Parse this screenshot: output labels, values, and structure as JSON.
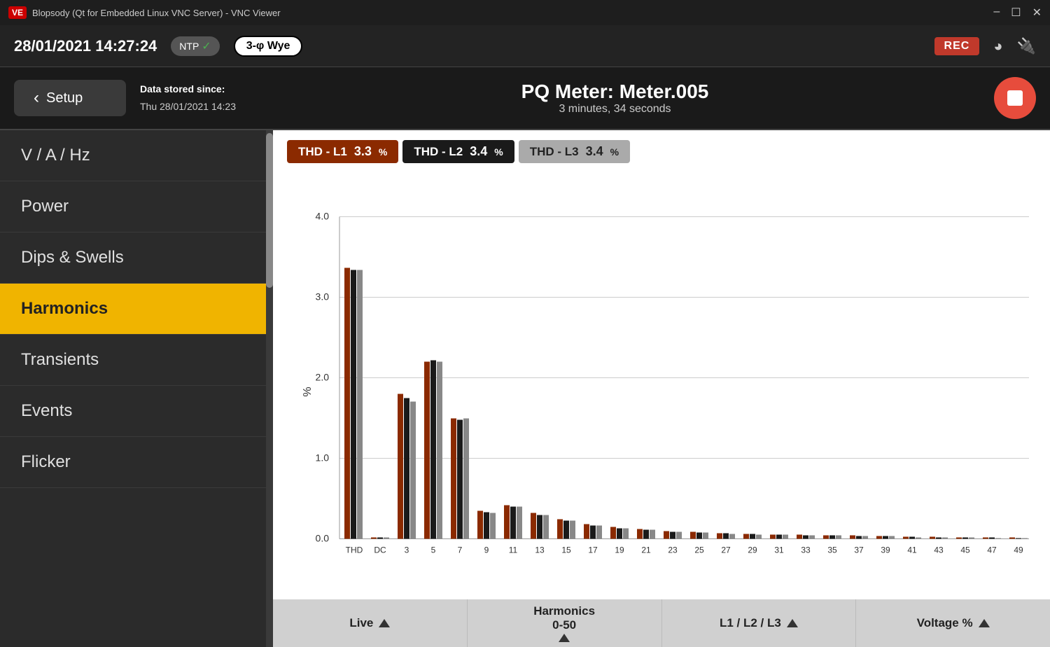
{
  "titlebar": {
    "icon": "VE",
    "title": "Blopsody (Qt for Embedded Linux VNC Server) - VNC Viewer",
    "minimize": "–",
    "maximize": "☐",
    "close": "✕"
  },
  "statusbar": {
    "datetime": "28/01/2021  14:27:24",
    "ntp_label": "NTP",
    "ntp_check": "✓",
    "wye_label": "3-φ Wye",
    "rec_label": "REC"
  },
  "headerbar": {
    "setup_label": "Setup",
    "back_arrow": "‹",
    "data_stored_label": "Data stored since:",
    "data_stored_date": "Thu 28/01/2021 14:23",
    "meter_title": "PQ Meter: Meter.005",
    "duration": "3 minutes, 34 seconds"
  },
  "sidebar": {
    "items": [
      {
        "id": "v-a-hz",
        "label": "V / A / Hz",
        "active": false
      },
      {
        "id": "power",
        "label": "Power",
        "active": false
      },
      {
        "id": "dips-swells",
        "label": "Dips & Swells",
        "active": false
      },
      {
        "id": "harmonics",
        "label": "Harmonics",
        "active": true
      },
      {
        "id": "transients",
        "label": "Transients",
        "active": false
      },
      {
        "id": "events",
        "label": "Events",
        "active": false
      },
      {
        "id": "flicker",
        "label": "Flicker",
        "active": false
      }
    ]
  },
  "thd": [
    {
      "label": "THD - L1",
      "value": "3.3",
      "unit": "%",
      "class": "l1"
    },
    {
      "label": "THD - L2",
      "value": "3.4",
      "unit": "%",
      "class": "l2"
    },
    {
      "label": "THD - L3",
      "value": "3.4",
      "unit": "%",
      "class": "l3"
    }
  ],
  "chart": {
    "y_axis_label": "%",
    "y_max": 4.0,
    "y_ticks": [
      0.0,
      1.0,
      2.0,
      3.0,
      4.0
    ],
    "x_labels": [
      "THD",
      "DC",
      "3",
      "5",
      "7",
      "9",
      "11",
      "13",
      "15",
      "17",
      "19",
      "21",
      "23",
      "25",
      "27",
      "29",
      "31",
      "33",
      "35",
      "37",
      "39",
      "41",
      "43",
      "45",
      "47",
      "49"
    ],
    "series": {
      "l1_color": "#8b2a00",
      "l2_color": "#1a1a1a",
      "l3_color": "#888",
      "bars": [
        {
          "x": "THD",
          "l1": 3.35,
          "l2": 3.3,
          "l3": 3.3
        },
        {
          "x": "DC",
          "l1": 0.02,
          "l2": 0.02,
          "l3": 0.02
        },
        {
          "x": "3",
          "l1": 1.8,
          "l2": 1.75,
          "l3": 1.7
        },
        {
          "x": "5",
          "l1": 2.2,
          "l2": 2.22,
          "l3": 2.2
        },
        {
          "x": "7",
          "l1": 1.5,
          "l2": 1.48,
          "l3": 1.5
        },
        {
          "x": "9",
          "l1": 0.35,
          "l2": 0.33,
          "l3": 0.32
        },
        {
          "x": "11",
          "l1": 0.42,
          "l2": 0.4,
          "l3": 0.4
        },
        {
          "x": "13",
          "l1": 0.32,
          "l2": 0.3,
          "l3": 0.3
        },
        {
          "x": "15",
          "l1": 0.25,
          "l2": 0.23,
          "l3": 0.23
        },
        {
          "x": "17",
          "l1": 0.18,
          "l2": 0.17,
          "l3": 0.17
        },
        {
          "x": "19",
          "l1": 0.15,
          "l2": 0.13,
          "l3": 0.13
        },
        {
          "x": "21",
          "l1": 0.12,
          "l2": 0.11,
          "l3": 0.11
        },
        {
          "x": "23",
          "l1": 0.1,
          "l2": 0.09,
          "l3": 0.09
        },
        {
          "x": "25",
          "l1": 0.09,
          "l2": 0.08,
          "l3": 0.08
        },
        {
          "x": "27",
          "l1": 0.07,
          "l2": 0.07,
          "l3": 0.06
        },
        {
          "x": "29",
          "l1": 0.06,
          "l2": 0.06,
          "l3": 0.05
        },
        {
          "x": "31",
          "l1": 0.05,
          "l2": 0.05,
          "l3": 0.05
        },
        {
          "x": "33",
          "l1": 0.05,
          "l2": 0.04,
          "l3": 0.04
        },
        {
          "x": "35",
          "l1": 0.04,
          "l2": 0.04,
          "l3": 0.04
        },
        {
          "x": "37",
          "l1": 0.04,
          "l2": 0.03,
          "l3": 0.03
        },
        {
          "x": "39",
          "l1": 0.03,
          "l2": 0.03,
          "l3": 0.03
        },
        {
          "x": "41",
          "l1": 0.03,
          "l2": 0.02,
          "l3": 0.02
        },
        {
          "x": "43",
          "l1": 0.02,
          "l2": 0.02,
          "l3": 0.02
        },
        {
          "x": "45",
          "l1": 0.02,
          "l2": 0.02,
          "l3": 0.02
        },
        {
          "x": "47",
          "l1": 0.02,
          "l2": 0.02,
          "l3": 0.01
        },
        {
          "x": "49",
          "l1": 0.02,
          "l2": 0.01,
          "l3": 0.01
        }
      ]
    }
  },
  "bottom_toolbar": {
    "buttons": [
      {
        "id": "live",
        "label": "Live"
      },
      {
        "id": "harmonics-range",
        "label": "Harmonics\n0-50"
      },
      {
        "id": "phase-select",
        "label": "L1 / L2 / L3"
      },
      {
        "id": "unit-select",
        "label": "Voltage %"
      }
    ]
  }
}
